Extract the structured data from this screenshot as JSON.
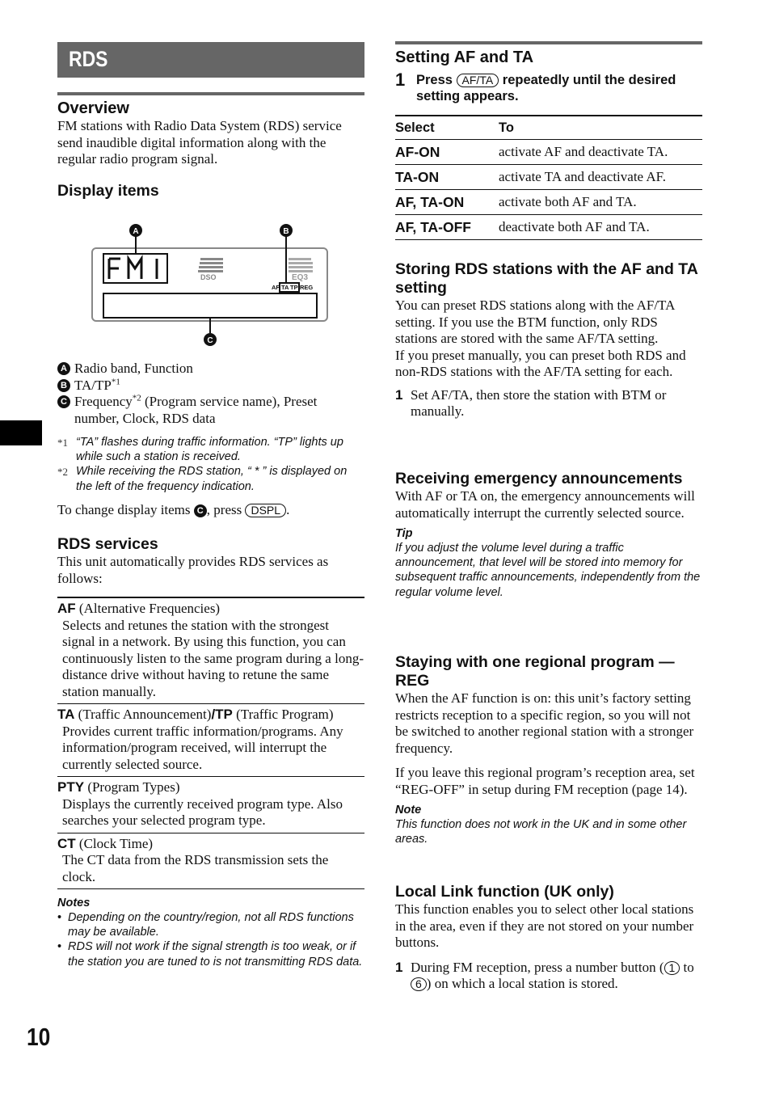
{
  "page": {
    "number": "10"
  },
  "left": {
    "title": "RDS",
    "overview": {
      "heading": "Overview",
      "body": "FM stations with Radio Data System (RDS) service send inaudible digital information along with the regular radio program signal."
    },
    "display_items": {
      "heading": "Display items",
      "diagram": {
        "band_text": "FM1",
        "dso_label": "DSO",
        "eq_label": "EQ3",
        "indicators": [
          "AF",
          "TA",
          "TP",
          "REG"
        ],
        "callouts": [
          "A",
          "B",
          "C"
        ]
      },
      "legend": [
        {
          "marker": "A",
          "text": "Radio band, Function"
        },
        {
          "marker": "B",
          "text": "TA/TP",
          "sup": "*1"
        },
        {
          "marker": "C",
          "text_before": "Frequency",
          "sup": "*2",
          "text": " (Program service name), Preset number, Clock, RDS data"
        }
      ],
      "footnotes": [
        {
          "mark": "*1",
          "text": "“TA” flashes during traffic information. “TP” lights up while such a station is received."
        },
        {
          "mark": "*2",
          "text": "While receiving the RDS station, “ * ” is displayed on the left of the frequency indication."
        }
      ],
      "change_text_before": "To change display items ",
      "change_marker": "C",
      "change_text_mid": ", press ",
      "change_key": "DSPL",
      "change_text_after": "."
    },
    "rds_services": {
      "heading": "RDS services",
      "intro": "This unit automatically provides RDS services as follows:",
      "items": [
        {
          "abbr": "AF",
          "name": " (Alternative Frequencies)",
          "desc": "Selects and retunes the station with the strongest signal in a network. By using this function, you can continuously listen to the same program during a long-distance drive without having to retune the same station manually."
        },
        {
          "abbr": "TA",
          "name": " (Traffic Announcement)",
          "abbr2": "/TP",
          "name2": " (Traffic Program)",
          "desc": "Provides current traffic information/programs. Any information/program received, will interrupt the currently selected source."
        },
        {
          "abbr": "PTY",
          "name": " (Program Types)",
          "desc": "Displays the currently received program type. Also searches your selected program type."
        },
        {
          "abbr": "CT",
          "name": " (Clock Time)",
          "desc": "The CT data from the RDS transmission sets the clock."
        }
      ],
      "notes_heading": "Notes",
      "notes": [
        "Depending on the country/region, not all RDS functions may be available.",
        "RDS will not work if the signal strength is too weak, or if the station you are tuned to is not transmitting RDS data."
      ]
    }
  },
  "right": {
    "setting_af_ta": {
      "heading": "Setting AF and TA",
      "step_num": "1",
      "step_before": "Press ",
      "step_key": "AF/TA",
      "step_after": " repeatedly until the desired setting appears.",
      "table": {
        "headers": [
          "Select",
          "To"
        ],
        "rows": [
          [
            "AF-ON",
            "activate AF and deactivate TA."
          ],
          [
            "TA-ON",
            "activate TA and deactivate AF."
          ],
          [
            "AF, TA-ON",
            "activate both AF and TA."
          ],
          [
            "AF, TA-OFF",
            "deactivate both AF and TA."
          ]
        ]
      }
    },
    "storing": {
      "heading": "Storing RDS stations with the AF and TA setting",
      "body1": "You can preset RDS stations along with the AF/TA setting. If you use the BTM function, only RDS stations are stored with the same AF/TA setting.",
      "body2": "If you preset manually, you can preset both RDS and non-RDS stations with the AF/TA setting for each.",
      "step_num": "1",
      "step": "Set AF/TA, then store the station with BTM or manually."
    },
    "emergency": {
      "heading": "Receiving emergency announcements",
      "body": "With AF or TA on, the emergency announcements will automatically interrupt the currently selected source.",
      "tip_heading": "Tip",
      "tip": "If you adjust the volume level during a traffic announcement, that level will be stored into memory for subsequent traffic announcements, independently from the regular volume level."
    },
    "regional": {
      "heading": "Staying with one regional program — REG",
      "body1": "When the AF function is on: this unit’s factory setting restricts reception to a specific region, so you will not be switched to another regional station with a stronger frequency.",
      "body2": "If you leave this regional program’s reception area, set “REG-OFF” in setup during FM reception (page 14).",
      "note_heading": "Note",
      "note": "This function does not work in the UK and in some other areas."
    },
    "local_link": {
      "heading": "Local Link function (UK only)",
      "body": "This function enables you to select other local stations in the area, even if they are not stored on your number buttons.",
      "step_num": "1",
      "step_before": "During FM reception, press a number button (",
      "key1": "1",
      "step_mid": " to ",
      "key2": "6",
      "step_after": ") on which a local station is stored."
    }
  }
}
